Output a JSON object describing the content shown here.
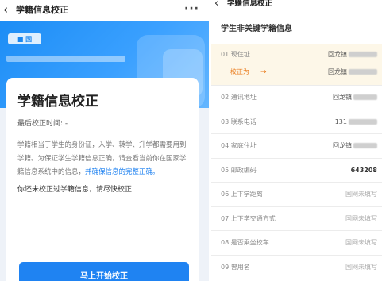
{
  "left": {
    "nav": {
      "back_icon": "‹",
      "title": "学籍信息校正",
      "more_icon": "···"
    },
    "hero": {
      "logo_text": "■ 国",
      "subtitle": ""
    },
    "card": {
      "title": "学籍信息校正",
      "last_check": "最后校正时间: -",
      "description_main": "学籍相当于学生的身份证，入学、转学、升学都需要用到学籍。为保证学生学籍信息正确，请查看当前你在国家学籍信息系统中的信息，",
      "description_link": "并确保信息的完整正确。",
      "warning": "你还未校正过学籍信息，请尽快校正",
      "start_button": "马上开始校正"
    }
  },
  "right": {
    "nav": {
      "back_icon": "‹",
      "title": "学籍信息校正"
    },
    "section_title": "学生非关键学籍信息",
    "rows": [
      {
        "label": "01.现住址",
        "value": "回龙镇"
      },
      {
        "label": "02.通讯地址",
        "value": "回龙镇"
      },
      {
        "label": "03.联系电话",
        "value": "131"
      },
      {
        "label": "04.家庭住址",
        "value": "回龙镇"
      },
      {
        "label": "05.邮政编码",
        "value": "643208"
      },
      {
        "label": "06.上下学距离",
        "value": "国网未填写"
      },
      {
        "label": "07.上下学交通方式",
        "value": "国网未填写"
      },
      {
        "label": "08.是否乘坐校车",
        "value": "国网未填写"
      },
      {
        "label": "09.曾用名",
        "value": "国网未填写"
      }
    ],
    "correction": {
      "label": "校正为",
      "arrow": "→",
      "value": "回龙镇"
    }
  }
}
